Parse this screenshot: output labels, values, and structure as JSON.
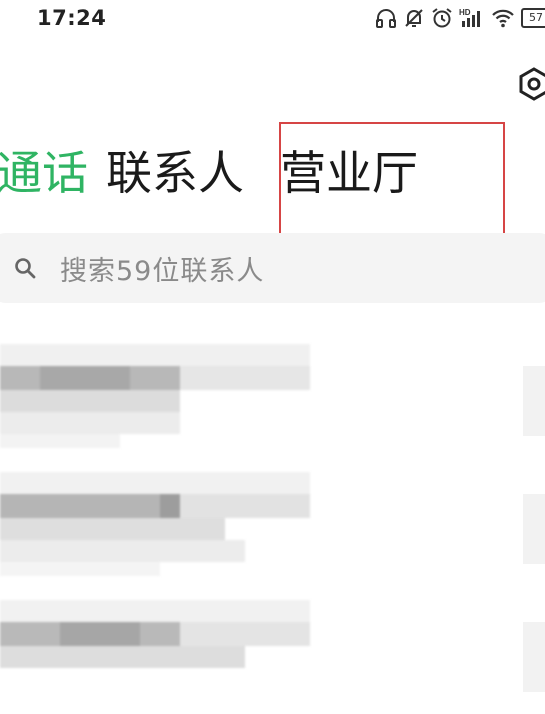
{
  "status_bar": {
    "time": "17:24",
    "icons": [
      "headphones-icon",
      "mute-bell-icon",
      "alarm-icon",
      "hd-signal-icon",
      "wifi-icon",
      "battery-icon"
    ],
    "battery_level": "57"
  },
  "header": {
    "tabs": [
      {
        "label": "通话",
        "active": true
      },
      {
        "label": "联系人",
        "active": false
      },
      {
        "label": "营业厅",
        "active": false
      }
    ],
    "accent_color": "#2fb463",
    "highlight_color": "#d64545"
  },
  "search": {
    "placeholder": "搜索59位联系人"
  },
  "contacts": {
    "count_shown": 3,
    "names_visible": false
  }
}
